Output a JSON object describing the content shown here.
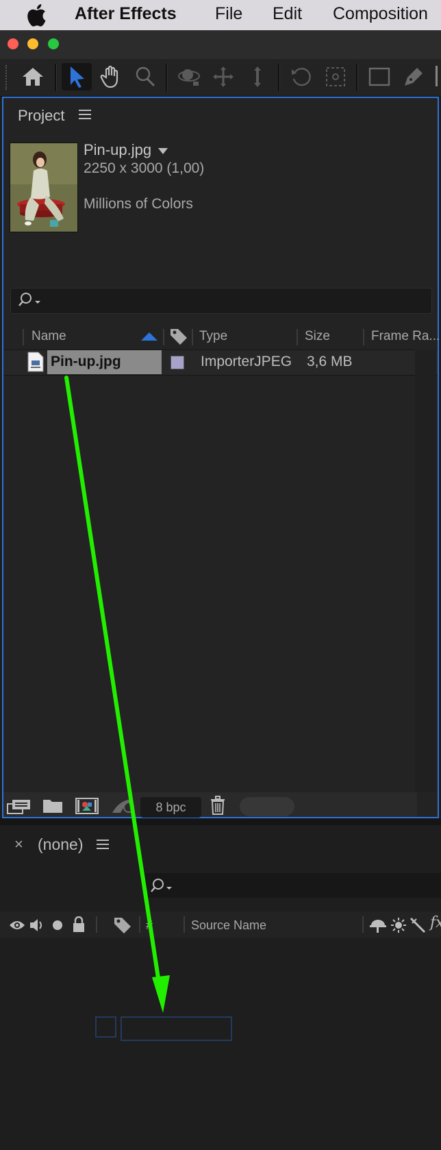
{
  "menubar": {
    "apple_icon": "apple-logo-icon",
    "app_name": "After Effects",
    "items": [
      "File",
      "Edit",
      "Composition"
    ]
  },
  "window": {
    "traffic_colors": [
      "#ff5f57",
      "#febc2e",
      "#28c840"
    ]
  },
  "toolbar": {
    "tools": [
      "home-icon",
      "selection-tool-icon",
      "hand-tool-icon",
      "zoom-tool-icon",
      "orbit-camera-icon",
      "pan-camera-icon",
      "dolly-camera-icon",
      "rotation-tool-icon",
      "anchor-point-tool-icon",
      "rectangle-tool-icon",
      "pen-tool-icon"
    ],
    "active_tool": "selection-tool-icon",
    "accent": "#2d73d9"
  },
  "project": {
    "title": "Project",
    "item": {
      "name": "Pin-up.jpg",
      "dimensions": "2250 x 3000 (1,00)",
      "colors": "Millions of Colors"
    },
    "columns": [
      "Name",
      "Type",
      "Size",
      "Frame Ra..."
    ],
    "rows": [
      {
        "name": "Pin-up.jpg",
        "label_color": "#a5a3c9",
        "type": "ImporterJPEG",
        "size": "3,6 MB"
      }
    ],
    "footer": {
      "bpc": "8 bpc"
    }
  },
  "timeline": {
    "tab_close": "×",
    "tab_label": "(none)",
    "columns": {
      "number": "#",
      "source_name": "Source Name"
    }
  },
  "annotation": {
    "arrow_color": "#22ee00"
  }
}
